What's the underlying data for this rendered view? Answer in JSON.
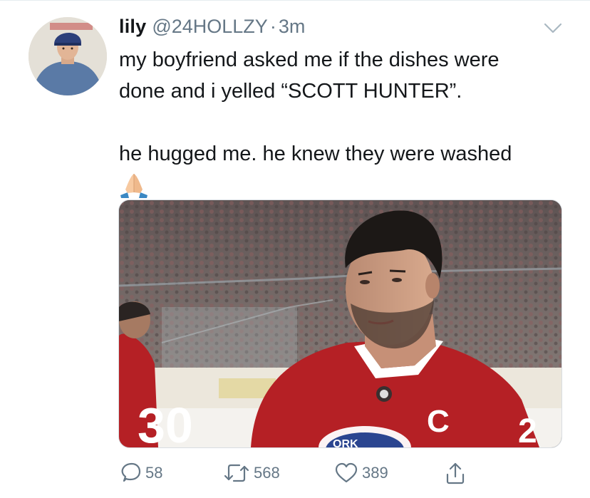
{
  "tweet": {
    "display_name": "lily",
    "handle": "@24HOLLZY",
    "separator": "·",
    "time": "3m",
    "text_line1": "my boyfriend asked me if the dishes were",
    "text_line2": "done and i yelled “SCOTT HUNTER”.",
    "text_line3": "he hugged me. he knew they were washed",
    "emoji": "folded-hands-emoji"
  },
  "media": {
    "jersey_number_left": "30",
    "jersey_text_partial": "ORK",
    "jersey_letter": "C",
    "jersey_number_right": "2",
    "description_hidden": false
  },
  "actions": {
    "reply_count": "58",
    "retweet_count": "568",
    "like_count": "389"
  },
  "colors": {
    "text": "#14171a",
    "secondary": "#657786",
    "icon": "#657786",
    "jersey_red": "#b52025"
  },
  "icons": [
    "chevron-down-icon",
    "reply-icon",
    "retweet-icon",
    "like-icon",
    "share-icon"
  ]
}
